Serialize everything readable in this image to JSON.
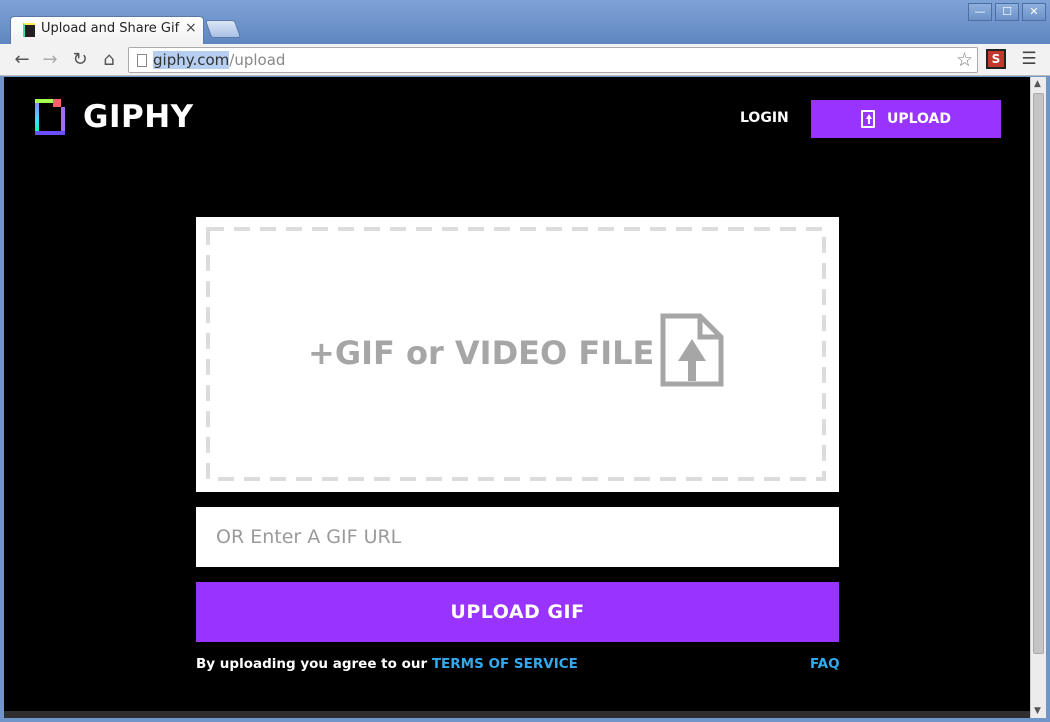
{
  "browser": {
    "tab_title": "Upload and Share Gif",
    "tab_close": "×",
    "url_selected": "giphy.com",
    "url_rest": "/upload",
    "window_buttons": [
      "—",
      "☐",
      "✕"
    ]
  },
  "header": {
    "logo_text": "GIPHY",
    "login_label": "LOGIN",
    "upload_label": "UPLOAD"
  },
  "main": {
    "dropzone_label": "+GIF or VIDEO FILE",
    "url_placeholder": "OR Enter A GIF URL",
    "upload_button_label": "UPLOAD GIF",
    "terms_prefix": "By uploading you agree to our ",
    "terms_link": "TERMS OF SERVICE",
    "faq_label": "FAQ"
  },
  "colors": {
    "brand_purple": "#9933ff",
    "link_blue": "#33aaee",
    "page_background": "#000000"
  }
}
